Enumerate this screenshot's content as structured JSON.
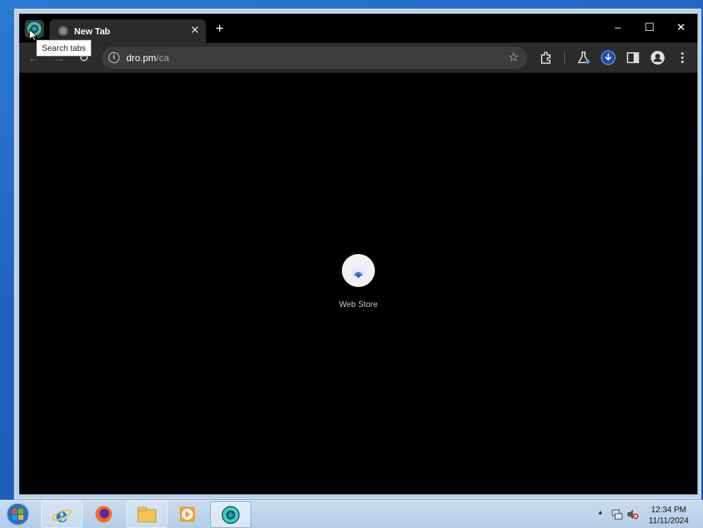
{
  "browser": {
    "tab": {
      "title": "New Tab",
      "close_glyph": "✕"
    },
    "new_tab_glyph": "+",
    "tooltip": "Search tabs",
    "window_controls": {
      "minimize": "–",
      "maximize": "☐",
      "close": "✕"
    },
    "nav": {
      "back": "←",
      "forward": "→",
      "reload": "↻"
    },
    "address": {
      "host": "dro.pm",
      "path": "/ca",
      "bookmark_glyph": "☆"
    },
    "icons": [
      "extensions-icon",
      "labs-icon",
      "download-icon",
      "side-panel-icon",
      "profile-icon",
      "menu-icon"
    ]
  },
  "new_tab_page": {
    "shortcuts": [
      {
        "label": "Web Store",
        "icon": "web-store-icon"
      }
    ]
  },
  "taskbar": {
    "items": [
      "internet-explorer-icon",
      "firefox-icon",
      "file-explorer-icon",
      "media-player-icon",
      "chrome-dev-icon"
    ],
    "clock": {
      "time": "12:34 PM",
      "date": "11/11/2024"
    }
  }
}
